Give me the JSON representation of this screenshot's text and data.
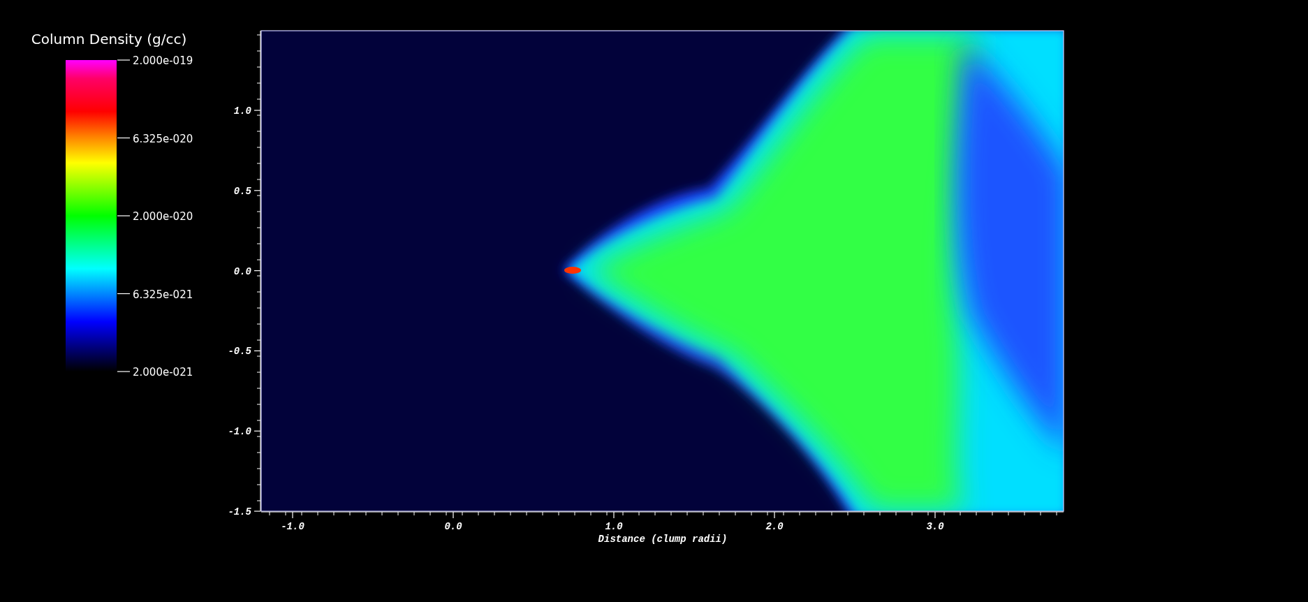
{
  "legend": {
    "title": "Column Density (g/cc)",
    "labels": [
      "2.000e-019",
      "6.325e-020",
      "2.000e-020",
      "6.325e-021",
      "2.000e-021"
    ]
  },
  "plot": {
    "ytick_labels": [
      "1.0",
      "0.5",
      "0.0",
      "-0.5",
      "-1.0",
      "-1.5"
    ],
    "xtick_labels": [
      "-1.0",
      "0.0",
      "1.0",
      "2.0",
      "3.0"
    ],
    "xlabel": "Distance (clump radii)"
  }
}
